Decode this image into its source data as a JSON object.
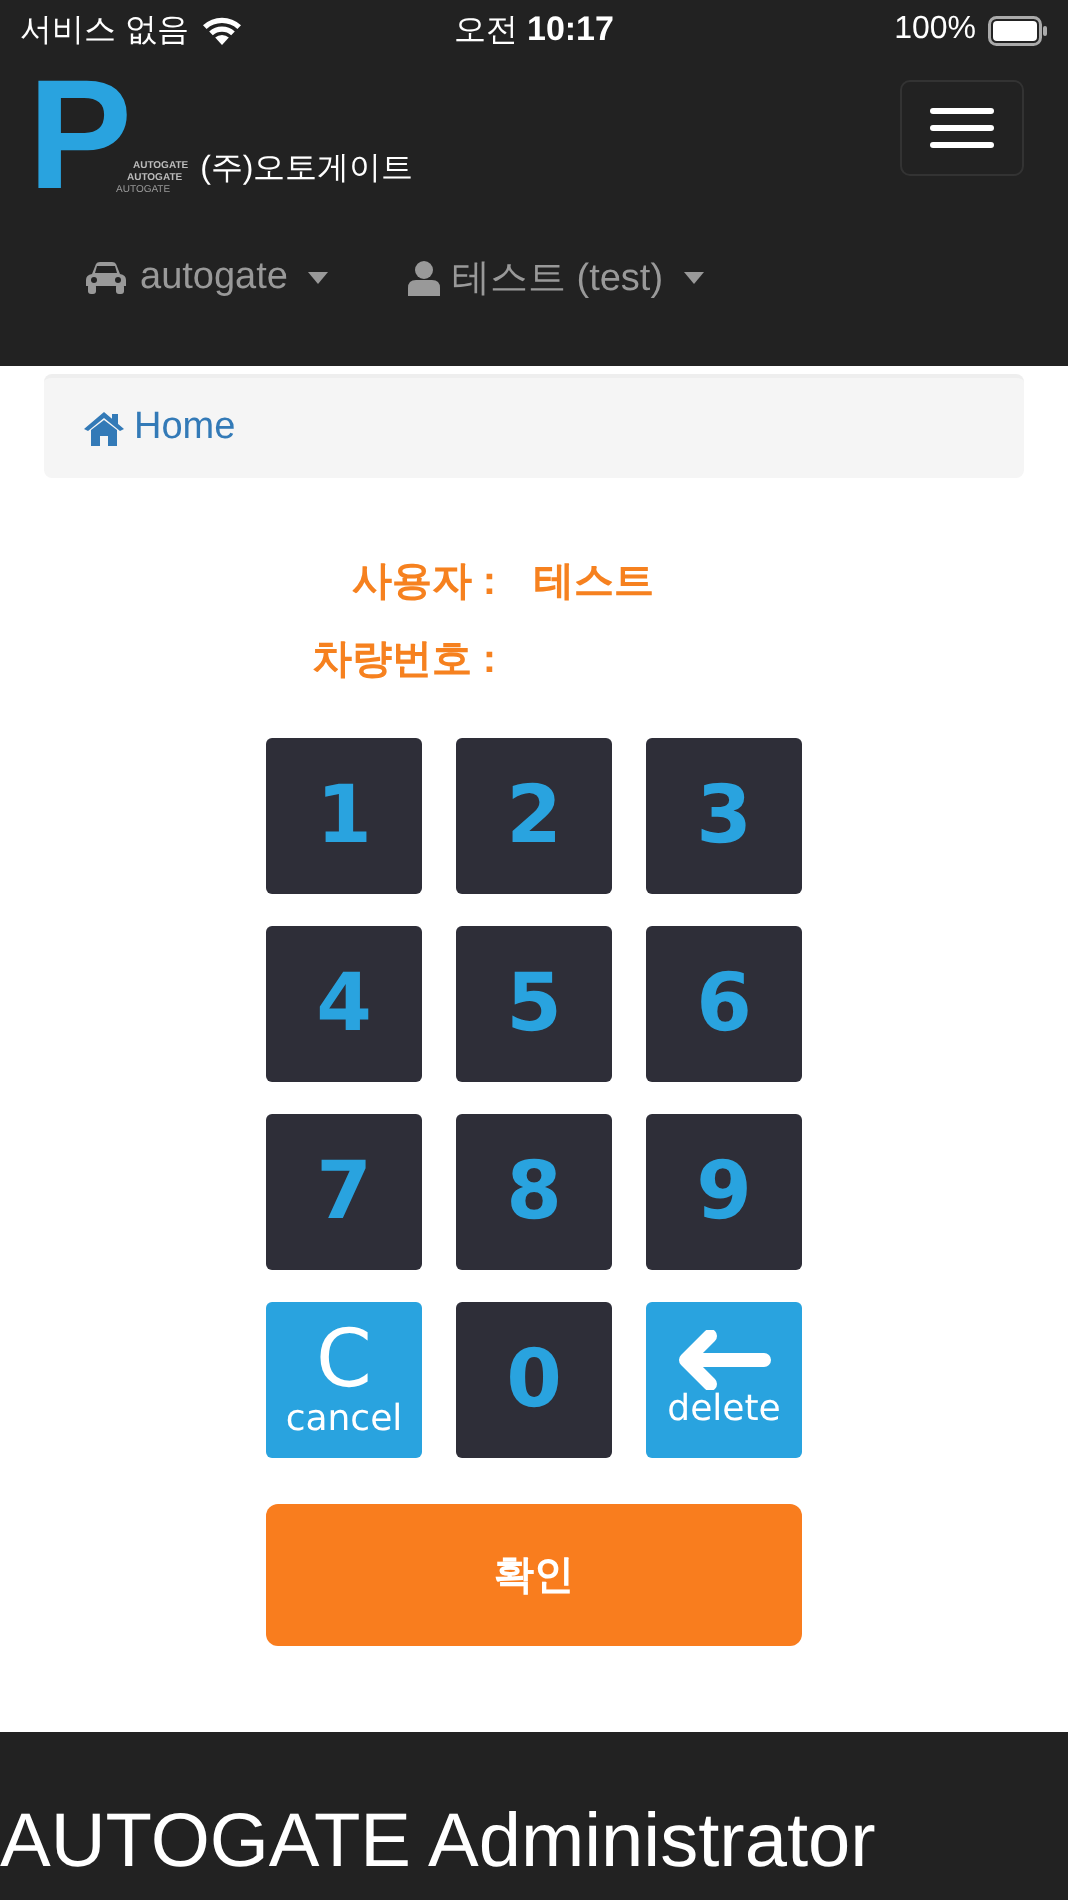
{
  "status_bar": {
    "carrier": "서비스 없음",
    "time_prefix": "오전",
    "time": "10:17",
    "battery": "100%"
  },
  "navbar": {
    "logo_letter": "P",
    "logo_marks": [
      "AUTOGATE",
      "AUTOGATE",
      "AUTOGATE"
    ],
    "brand": "(주)오토게이트",
    "menus": [
      {
        "kind": "car",
        "label": "autogate"
      },
      {
        "kind": "user",
        "label": "테스트 (test)"
      }
    ]
  },
  "breadcrumb": {
    "label": "Home"
  },
  "info": [
    {
      "label": "사용자 :",
      "value": "테스트"
    },
    {
      "label": "차량번호 :"
    }
  ],
  "keypad": [
    {
      "kind": "digit",
      "label": "1"
    },
    {
      "kind": "digit",
      "label": "2"
    },
    {
      "kind": "digit",
      "label": "3"
    },
    {
      "kind": "digit",
      "label": "4"
    },
    {
      "kind": "digit",
      "label": "5"
    },
    {
      "kind": "digit",
      "label": "6"
    },
    {
      "kind": "digit",
      "label": "7"
    },
    {
      "kind": "digit",
      "label": "8"
    },
    {
      "kind": "digit",
      "label": "9"
    },
    {
      "kind": "cancel",
      "symbol": "C",
      "label": "cancel"
    },
    {
      "kind": "digit",
      "label": "0"
    },
    {
      "kind": "delete",
      "label": "delete"
    }
  ],
  "confirm_button": "확인",
  "footer": {
    "title": "AUTOGATE Administrator"
  }
}
